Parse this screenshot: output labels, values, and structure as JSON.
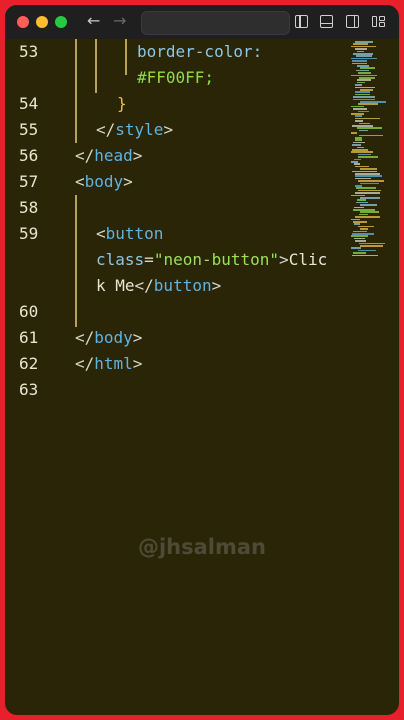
{
  "window": {
    "nav_back_icon": "arrow-left-icon",
    "nav_forward_icon": "arrow-right-icon",
    "toolbar_icons": [
      "sidebar-left-icon",
      "panel-bottom-icon",
      "sidebar-right-icon",
      "layout-grid-icon"
    ]
  },
  "editor": {
    "lines": [
      {
        "number": "53",
        "text_parts": [
          "border-color:"
        ]
      },
      {
        "number": "",
        "text_parts": [
          "#FF00FF;"
        ]
      },
      {
        "number": "54",
        "text_parts": [
          "}"
        ]
      },
      {
        "number": "55",
        "text_parts": [
          "</",
          "style",
          ">"
        ]
      },
      {
        "number": "56",
        "text_parts": [
          "</",
          "head",
          ">"
        ]
      },
      {
        "number": "57",
        "text_parts": [
          "<",
          "body",
          ">"
        ]
      },
      {
        "number": "58",
        "text_parts": []
      },
      {
        "number": "59",
        "text_parts": [
          "<",
          "button"
        ]
      },
      {
        "number": "",
        "text_parts": [
          "class",
          "=",
          "\"neon-button\"",
          ">",
          "Clic"
        ]
      },
      {
        "number": "",
        "text_parts": [
          "k Me",
          "</",
          "button",
          ">"
        ]
      },
      {
        "number": "60",
        "text_parts": []
      },
      {
        "number": "61",
        "text_parts": [
          "</",
          "body",
          ">"
        ]
      },
      {
        "number": "62",
        "text_parts": [
          "</",
          "html",
          ">"
        ]
      },
      {
        "number": "63",
        "text_parts": []
      }
    ]
  },
  "watermark": "@jhsalman",
  "colors": {
    "background": "#2b2508",
    "frame_border": "#e8202c",
    "attribute": "#8fc7e0",
    "value": "#92d94a",
    "brace": "#e8c24a",
    "tag": "#5fb3e0"
  }
}
